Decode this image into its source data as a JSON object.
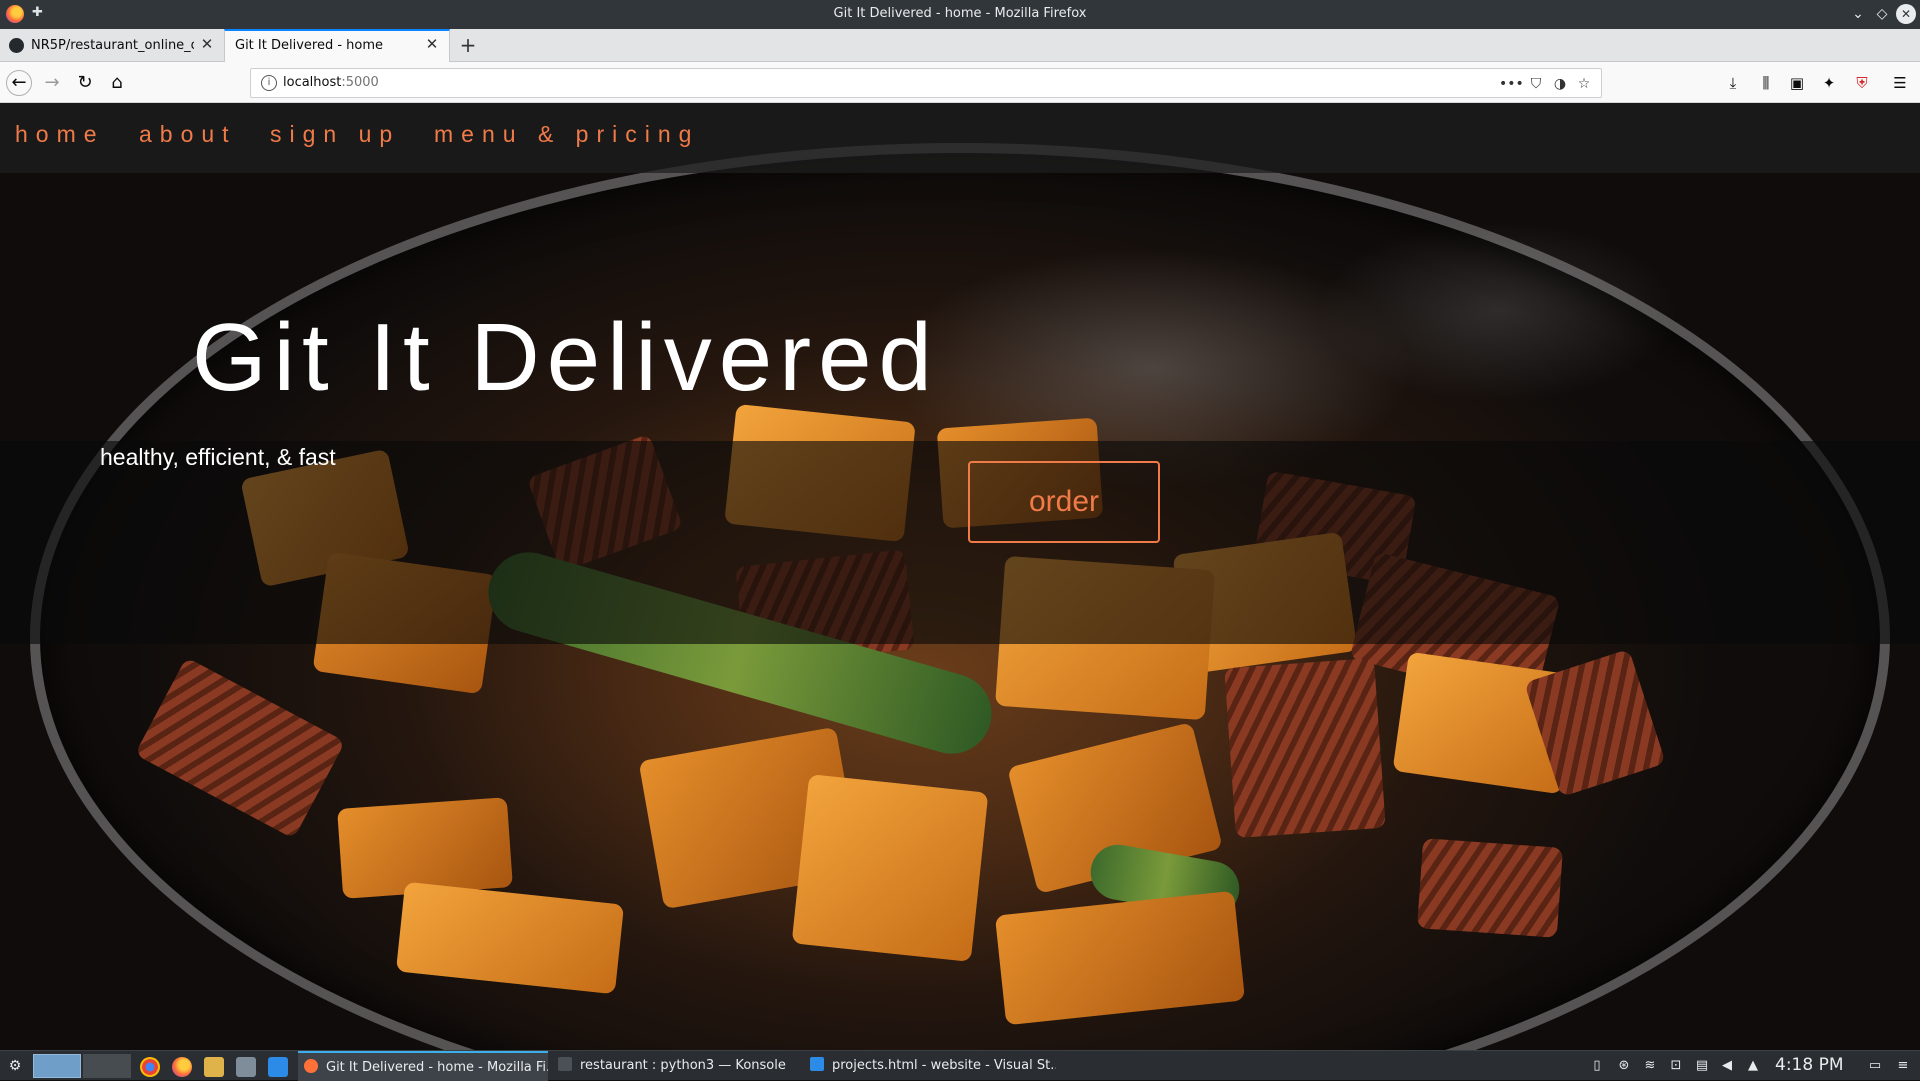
{
  "window": {
    "title": "Git It Delivered - home - Mozilla Firefox",
    "controls": {
      "minimize": "⌄",
      "maximize": "◇",
      "close": "✕"
    }
  },
  "tabs": [
    {
      "label": "NR5P/restaurant_online_o",
      "close": "✕",
      "active": false
    },
    {
      "label": "Git It Delivered - home",
      "close": "✕",
      "active": true
    }
  ],
  "new_tab": "+",
  "nav": {
    "back": "←",
    "forward": "→",
    "reload": "↻",
    "home": "⌂",
    "url_host": "localhost",
    "url_port": ":5000",
    "page_actions": "•••",
    "toolbar_icons": [
      "download-icon",
      "library-icon",
      "sidebar-icon",
      "extension-icon",
      "shield-icon",
      "menu-icon"
    ]
  },
  "site": {
    "nav_links": [
      "home",
      "about",
      "sign up",
      "menu & pricing"
    ],
    "title": "Git It Delivered",
    "tagline": "healthy, efficient, & fast",
    "order_label": "order",
    "accent_color": "#f07a48"
  },
  "taskbar": {
    "tasks": [
      {
        "label": "Git It Delivered - home - Mozilla Fi...",
        "active": true
      },
      {
        "label": "restaurant : python3 — Konsole",
        "active": false
      },
      {
        "label": "projects.html - website - Visual St...",
        "active": false
      }
    ],
    "clock": "4:18 PM"
  }
}
